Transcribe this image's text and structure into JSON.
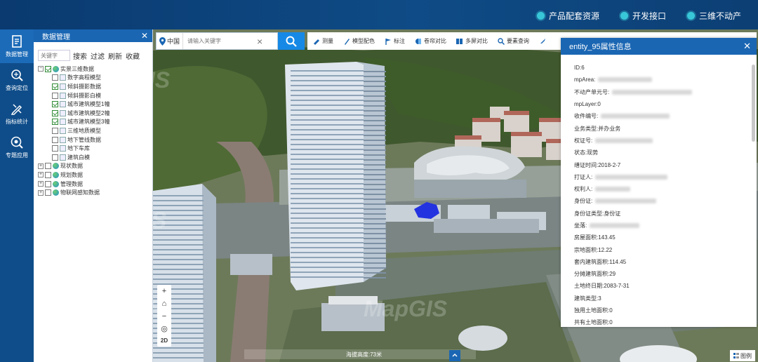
{
  "header": {
    "links": [
      "产品配套资源",
      "开发接口",
      "三维不动产"
    ]
  },
  "rail": {
    "items": [
      "数据管理",
      "查询定位",
      "指标统计",
      "专题应用"
    ]
  },
  "panel": {
    "title": "数据管理",
    "keyword_placeholder": "关键字",
    "buttons": [
      "搜索",
      "过滤",
      "刷新",
      "收藏"
    ],
    "tree": [
      {
        "label": "实景三维数据",
        "level": 0,
        "expanded": true,
        "checked": true
      },
      {
        "label": "数字高程模型",
        "level": 1,
        "checked": false
      },
      {
        "label": "倾斜摄影数据",
        "level": 1,
        "checked": true
      },
      {
        "label": "倾斜摄影白模",
        "level": 1,
        "checked": false
      },
      {
        "label": "城市建筑模型1幢",
        "level": 1,
        "checked": true
      },
      {
        "label": "城市建筑模型2幢",
        "level": 1,
        "checked": true
      },
      {
        "label": "城市建筑模型3幢",
        "level": 1,
        "checked": true
      },
      {
        "label": "三维地质模型",
        "level": 1,
        "checked": false
      },
      {
        "label": "地下管线数据",
        "level": 1,
        "checked": false
      },
      {
        "label": "地下车库",
        "level": 1,
        "checked": false
      },
      {
        "label": "建筑白模",
        "level": 1,
        "checked": false
      },
      {
        "label": "现状数据",
        "level": 0,
        "expanded": false,
        "checked": false
      },
      {
        "label": "规划数据",
        "level": 0,
        "expanded": false,
        "checked": false
      },
      {
        "label": "管理数据",
        "level": 0,
        "expanded": false,
        "checked": false
      },
      {
        "label": "物联网感知数据",
        "level": 0,
        "expanded": false,
        "checked": false
      }
    ]
  },
  "map": {
    "region": "中国",
    "search_placeholder": "请输入关键字",
    "toolbar": [
      "测量",
      "模型配色",
      "标注",
      "卷帘对比",
      "多屏对比",
      "要素查询"
    ],
    "zoom": [
      "+",
      "⌂",
      "−",
      "◎",
      "2D"
    ],
    "status_text": "海拔高度:73米",
    "legend_label": "图例",
    "watermark": "MapGIS"
  },
  "attributes": {
    "title": "entity_95属性信息",
    "rows": [
      {
        "label": "ID: ",
        "value": "6"
      },
      {
        "label": "mpArea: ",
        "value": ""
      },
      {
        "label": "不动产单元号: ",
        "value": ""
      },
      {
        "label": "mpLayer: ",
        "value": "0"
      },
      {
        "label": "收件编号: ",
        "value": ""
      },
      {
        "label": "业务类型: ",
        "value": "并办业务"
      },
      {
        "label": "权证号: ",
        "value": ""
      },
      {
        "label": "状态: ",
        "value": "现势"
      },
      {
        "label": "缮证时间: ",
        "value": "2018-2-7"
      },
      {
        "label": "打证人: ",
        "value": ""
      },
      {
        "label": "权利人: ",
        "value": ""
      },
      {
        "label": "身份证: ",
        "value": ""
      },
      {
        "label": "身份证类型: ",
        "value": "身份证"
      },
      {
        "label": "坐落: ",
        "value": ""
      },
      {
        "label": "房屋面积: ",
        "value": "143.45"
      },
      {
        "label": "宗地面积: ",
        "value": "12.22"
      },
      {
        "label": "套内建筑面积: ",
        "value": "114.45"
      },
      {
        "label": "分摊建筑面积: ",
        "value": "29"
      },
      {
        "label": "土地终日期: ",
        "value": "2083-7-31"
      },
      {
        "label": "建筑类型: ",
        "value": "3"
      },
      {
        "label": "独用土地面积: ",
        "value": "0"
      },
      {
        "label": "共有土地面积: ",
        "value": "0"
      }
    ]
  },
  "colors": {
    "header": "#0f4b86",
    "accent": "#1a66b3",
    "search_button": "#1689e6",
    "highlight_entity": "#2433e0"
  }
}
